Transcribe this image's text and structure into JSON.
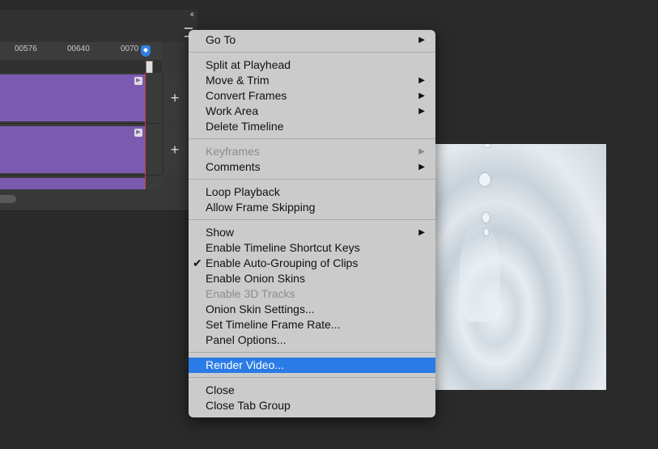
{
  "timeline": {
    "ruler_ticks": [
      "00576",
      "00640",
      "0070"
    ],
    "collapse_glyph": "‹‹",
    "add_button_label": "+"
  },
  "context_menu": {
    "groups": [
      [
        {
          "label": "Go To",
          "submenu": true,
          "enabled": true
        }
      ],
      [
        {
          "label": "Split at Playhead",
          "submenu": false,
          "enabled": true
        },
        {
          "label": "Move & Trim",
          "submenu": true,
          "enabled": true
        },
        {
          "label": "Convert Frames",
          "submenu": true,
          "enabled": true
        },
        {
          "label": "Work Area",
          "submenu": true,
          "enabled": true
        },
        {
          "label": "Delete Timeline",
          "submenu": false,
          "enabled": true
        }
      ],
      [
        {
          "label": "Keyframes",
          "submenu": true,
          "enabled": false
        },
        {
          "label": "Comments",
          "submenu": true,
          "enabled": true
        }
      ],
      [
        {
          "label": "Loop Playback",
          "submenu": false,
          "enabled": true
        },
        {
          "label": "Allow Frame Skipping",
          "submenu": false,
          "enabled": true
        }
      ],
      [
        {
          "label": "Show",
          "submenu": true,
          "enabled": true
        },
        {
          "label": "Enable Timeline Shortcut Keys",
          "submenu": false,
          "enabled": true
        },
        {
          "label": "Enable Auto-Grouping of Clips",
          "submenu": false,
          "enabled": true,
          "checked": true
        },
        {
          "label": "Enable Onion Skins",
          "submenu": false,
          "enabled": true
        },
        {
          "label": "Enable 3D Tracks",
          "submenu": false,
          "enabled": false
        },
        {
          "label": "Onion Skin Settings...",
          "submenu": false,
          "enabled": true
        },
        {
          "label": "Set Timeline Frame Rate...",
          "submenu": false,
          "enabled": true
        },
        {
          "label": "Panel Options...",
          "submenu": false,
          "enabled": true
        }
      ],
      [
        {
          "label": "Render Video...",
          "submenu": false,
          "enabled": true,
          "highlighted": true
        }
      ],
      [
        {
          "label": "Close",
          "submenu": false,
          "enabled": true
        },
        {
          "label": "Close Tab Group",
          "submenu": false,
          "enabled": true
        }
      ]
    ],
    "submenu_glyph": "▶",
    "check_glyph": "✔"
  },
  "colors": {
    "clip": "#7a5bb0",
    "playhead": "#2f7fe0",
    "highlight": "#2a7be6",
    "menu_bg": "#d2d2d2"
  }
}
